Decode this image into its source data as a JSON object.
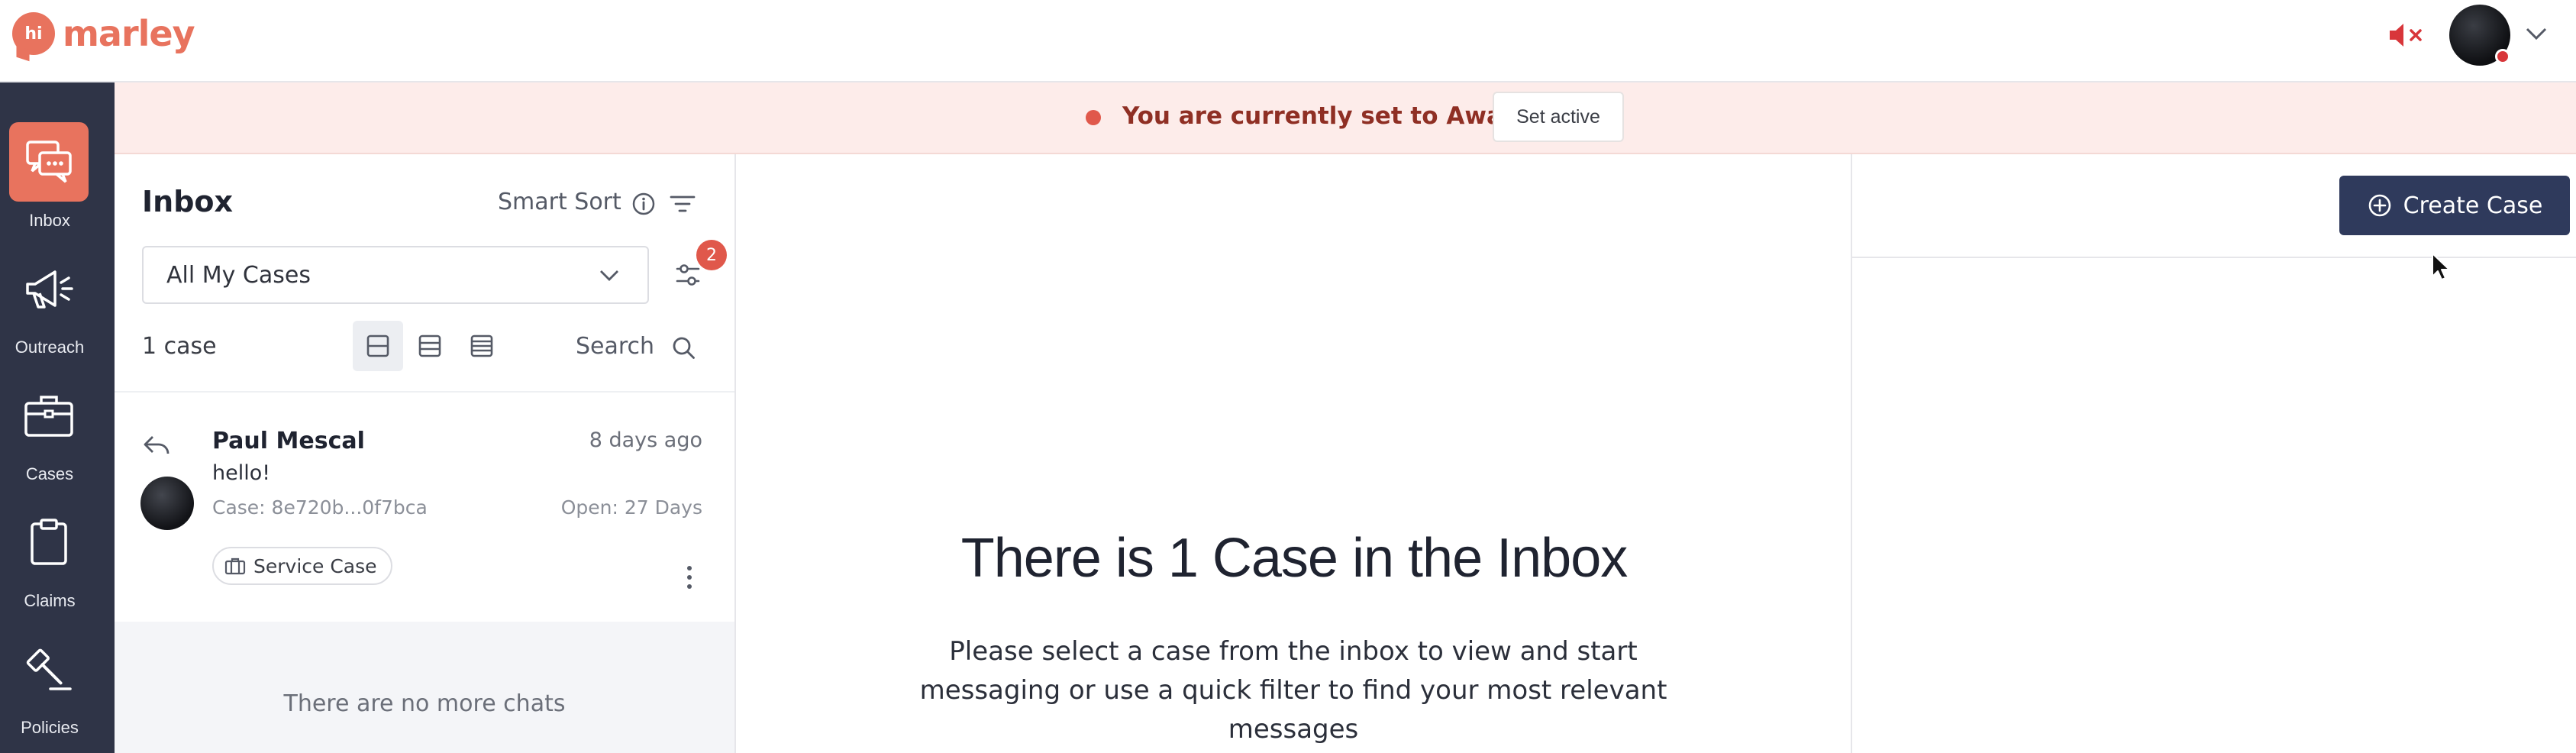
{
  "app": {
    "logo_mark": "hi",
    "logo_text": "marley",
    "brand_color": "#e8735e",
    "nav_bg": "#2f3447"
  },
  "header": {
    "mute_icon": "speaker-muted-icon",
    "status_color": "#d8363a"
  },
  "nav": {
    "items": [
      {
        "label": "Inbox",
        "icon": "chat-bubbles-icon",
        "active": true
      },
      {
        "label": "Outreach",
        "icon": "megaphone-icon",
        "active": false
      },
      {
        "label": "Cases",
        "icon": "briefcase-icon",
        "active": false
      },
      {
        "label": "Claims",
        "icon": "clipboard-icon",
        "active": false
      },
      {
        "label": "Policies",
        "icon": "gavel-icon",
        "active": false
      }
    ]
  },
  "banner": {
    "text": "You are currently set to Away",
    "button": "Set active"
  },
  "inbox": {
    "title": "Inbox",
    "smart_sort": "Smart Sort",
    "filter_value": "All My Cases",
    "filter_badge": "2",
    "count": "1 case",
    "search": "Search",
    "cases": [
      {
        "name": "Paul Mescal",
        "time": "8 days ago",
        "message": "hello!",
        "case_id": "Case: 8e720b...0f7bca",
        "open_for": "Open: 27 Days",
        "tag": "Service Case"
      }
    ],
    "no_more": "There are no more chats"
  },
  "center": {
    "title": "There is 1 Case in the Inbox",
    "subtitle": "Please select a case from the inbox to view and start messaging or use a quick filter to find your most relevant messages"
  },
  "right": {
    "create_button": "Create Case",
    "accent": "#2f3a5c"
  }
}
